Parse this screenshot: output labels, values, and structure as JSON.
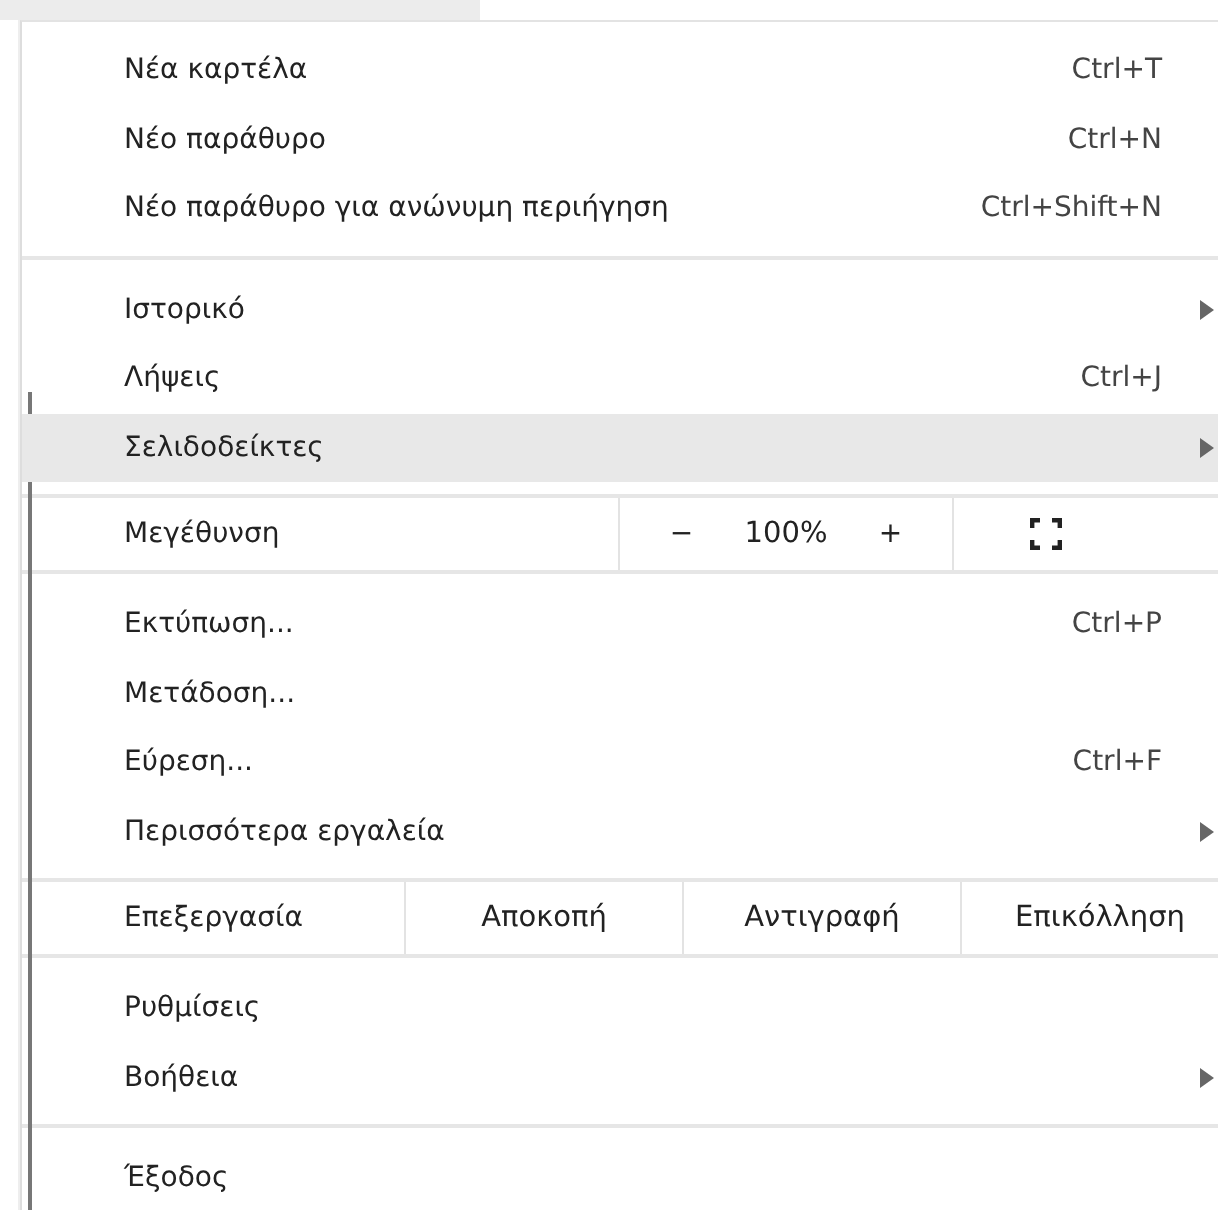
{
  "groups": [
    {
      "items": [
        {
          "kind": "item",
          "label": "Νέα καρτέλα",
          "shortcut": "Ctrl+T",
          "submenu": false,
          "selected": false
        },
        {
          "kind": "item",
          "label": "Νέο παράθυρο",
          "shortcut": "Ctrl+N",
          "submenu": false,
          "selected": false
        },
        {
          "kind": "item",
          "label": "Νέο παράθυρο για ανώνυμη περιήγηση",
          "shortcut": "Ctrl+Shift+N",
          "submenu": false,
          "selected": false
        }
      ]
    },
    {
      "items": [
        {
          "kind": "item",
          "label": "Ιστορικό",
          "submenu": true,
          "selected": false
        },
        {
          "kind": "item",
          "label": "Λήψεις",
          "shortcut": "Ctrl+J",
          "submenu": false,
          "selected": false
        },
        {
          "kind": "item",
          "label": "Σελιδοδείκτες",
          "submenu": true,
          "selected": true
        }
      ]
    },
    {
      "items": [
        {
          "kind": "zoom",
          "label": "Μεγέθυνση",
          "minus": "−",
          "value": "100%",
          "plus": "+"
        }
      ]
    },
    {
      "items": [
        {
          "kind": "item",
          "label": "Εκτύπωση...",
          "shortcut": "Ctrl+P",
          "submenu": false,
          "selected": false
        },
        {
          "kind": "item",
          "label": "Μετάδοση...",
          "submenu": false,
          "selected": false
        },
        {
          "kind": "item",
          "label": "Εύρεση...",
          "shortcut": "Ctrl+F",
          "submenu": false,
          "selected": false
        },
        {
          "kind": "item",
          "label": "Περισσότερα εργαλεία",
          "submenu": true,
          "selected": false
        }
      ]
    },
    {
      "items": [
        {
          "kind": "edit",
          "label": "Επεξεργασία",
          "actions": [
            "Αποκοπή",
            "Αντιγραφή",
            "Επικόλληση"
          ]
        }
      ]
    },
    {
      "items": [
        {
          "kind": "item",
          "label": "Ρυθμίσεις",
          "submenu": false,
          "selected": false
        },
        {
          "kind": "item",
          "label": "Βοήθεια",
          "submenu": true,
          "selected": false
        }
      ]
    },
    {
      "items": [
        {
          "kind": "item",
          "label": "Έξοδος",
          "submenu": false,
          "selected": false
        }
      ]
    }
  ]
}
